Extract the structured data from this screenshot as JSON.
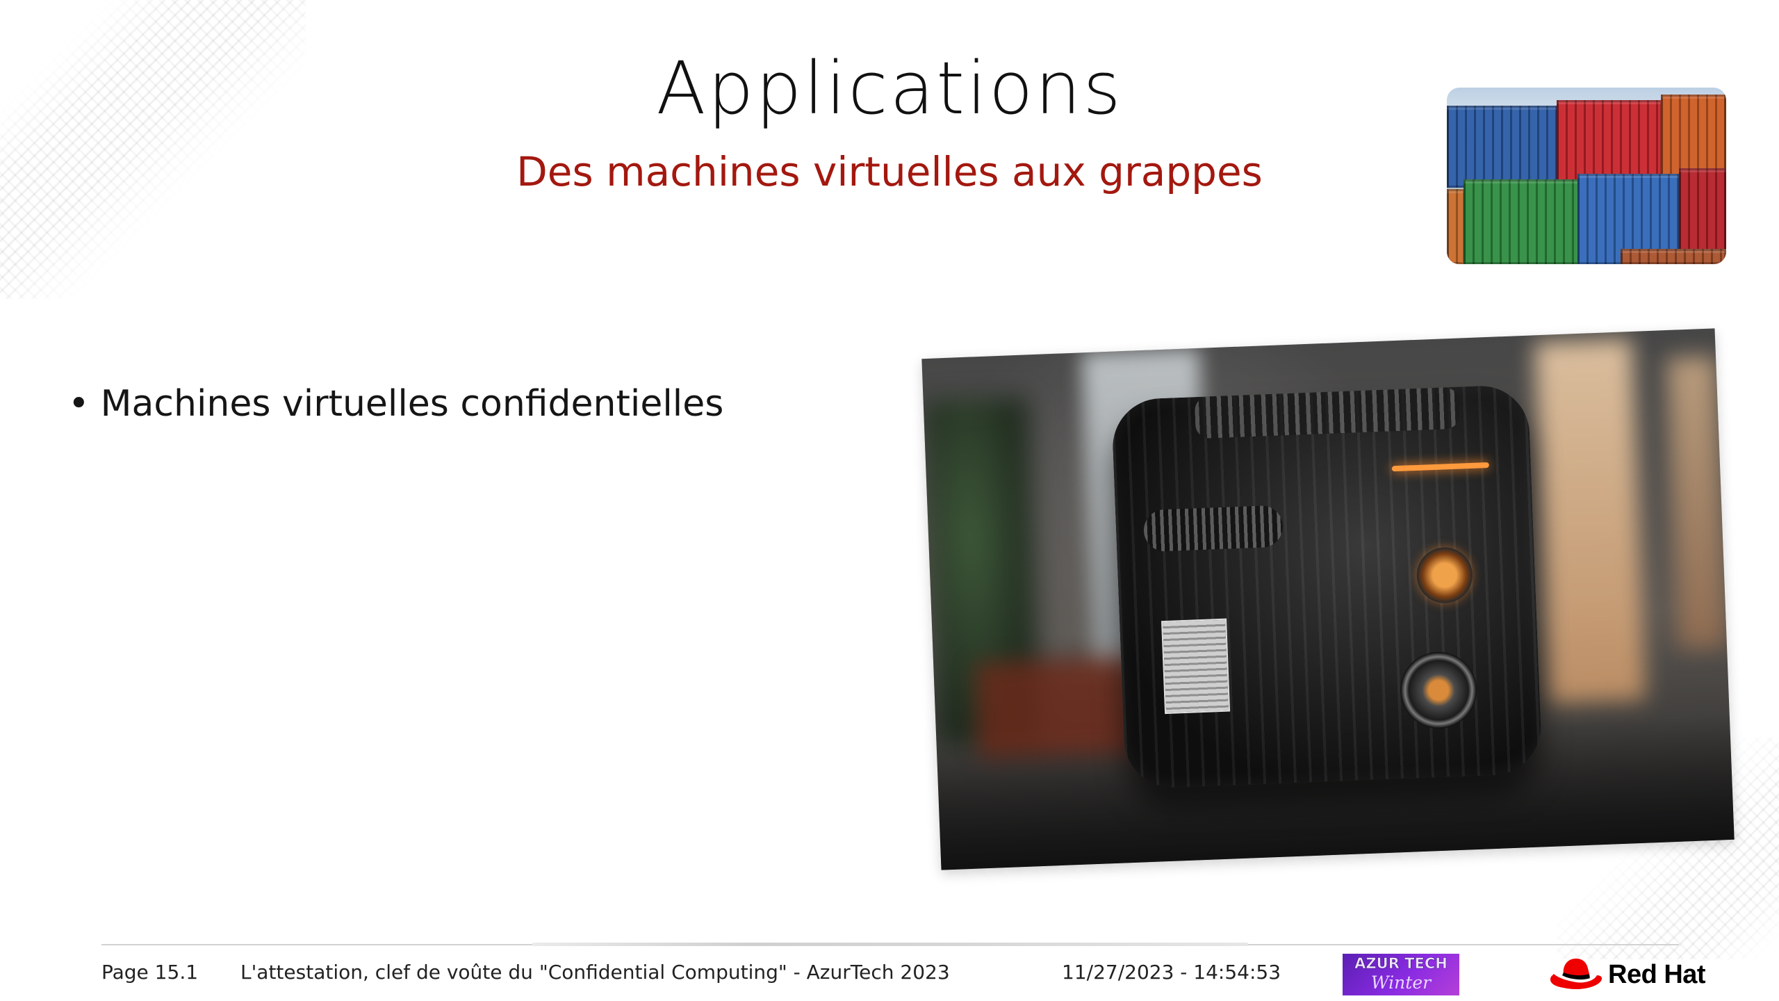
{
  "slide": {
    "title": "Applications",
    "subtitle": "Des machines virtuelles aux grappes",
    "bullets": [
      {
        "marker": "•",
        "text": "Machines virtuelles confidentielles"
      }
    ]
  },
  "footer": {
    "page": "Page 15.1",
    "talk": "L'attestation, clef de voûte du \"Confidential Computing\" - AzurTech 2023",
    "datetime": "11/27/2023 - 14:54:53",
    "event_logo": {
      "line1": "AZUR TECH",
      "line2": "Winter"
    },
    "brand_logo": {
      "text": "Red Hat",
      "icon": "red-hat-fedora-icon"
    }
  },
  "images": [
    {
      "name": "shipping-containers-thumbnail"
    },
    {
      "name": "steampunk-machine-photo"
    }
  ],
  "colors": {
    "subtitle": "#a3180f",
    "text": "#151515",
    "redhat_red": "#ee0000",
    "azur_purple": "#8a2be2"
  }
}
